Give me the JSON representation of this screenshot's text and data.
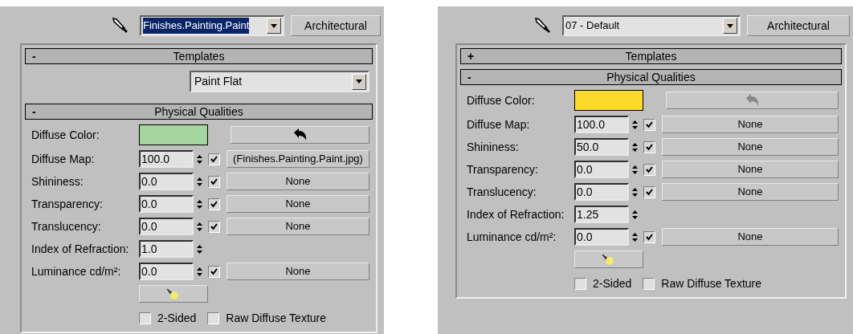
{
  "panels": [
    {
      "material": {
        "value": "Finishes.Painting.Paint",
        "selected": true
      },
      "type_button": "Architectural",
      "templates": {
        "toggle": "-",
        "title": "Templates",
        "template": "Paint Flat"
      },
      "physical": {
        "toggle": "-",
        "title": "Physical Qualities",
        "diffuse_color_label": "Diffuse Color:",
        "swatch": {
          "color": "#a5d6a0"
        },
        "undo_enabled": true,
        "rows": [
          {
            "kind": "map",
            "label": "Diffuse Map:",
            "value": "100.0",
            "checked": true,
            "map": "(Finishes.Painting.Paint.jpg)"
          },
          {
            "kind": "map",
            "label": "Shininess:",
            "value": "0.0",
            "checked": true,
            "map": "None"
          },
          {
            "kind": "map",
            "label": "Transparency:",
            "value": "0.0",
            "checked": true,
            "map": "None"
          },
          {
            "kind": "map",
            "label": "Translucency:",
            "value": "0.0",
            "checked": true,
            "map": "None"
          },
          {
            "kind": "spinner",
            "label": "Index of Refraction:",
            "value": "1.0"
          },
          {
            "kind": "map",
            "label": "Luminance cd/m²:",
            "value": "0.0",
            "checked": true,
            "map": "None"
          }
        ],
        "options": [
          {
            "label": "2-Sided",
            "checked": false
          },
          {
            "label": "Raw Diffuse Texture",
            "checked": false
          }
        ]
      }
    },
    {
      "material": {
        "value": "07 - Default",
        "selected": false
      },
      "type_button": "Architectural",
      "templates": {
        "toggle": "+",
        "title": "Templates"
      },
      "physical": {
        "toggle": "-",
        "title": "Physical Qualities",
        "diffuse_color_label": "Diffuse Color:",
        "swatch": {
          "color": "#fbd92d"
        },
        "undo_enabled": false,
        "rows": [
          {
            "kind": "map",
            "label": "Diffuse Map:",
            "value": "100.0",
            "checked": true,
            "map": "None"
          },
          {
            "kind": "map",
            "label": "Shininess:",
            "value": "50.0",
            "checked": true,
            "map": "None"
          },
          {
            "kind": "map",
            "label": "Transparency:",
            "value": "0.0",
            "checked": true,
            "map": "None"
          },
          {
            "kind": "map",
            "label": "Translucency:",
            "value": "0.0",
            "checked": true,
            "map": "None"
          },
          {
            "kind": "spinner",
            "label": "Index of Refraction:",
            "value": "1.25"
          },
          {
            "kind": "map",
            "label": "Luminance cd/m²:",
            "value": "0.0",
            "checked": true,
            "map": "None"
          }
        ],
        "options": [
          {
            "label": "2-Sided",
            "checked": false
          },
          {
            "label": "Raw Diffuse Texture",
            "checked": false
          }
        ]
      }
    }
  ]
}
